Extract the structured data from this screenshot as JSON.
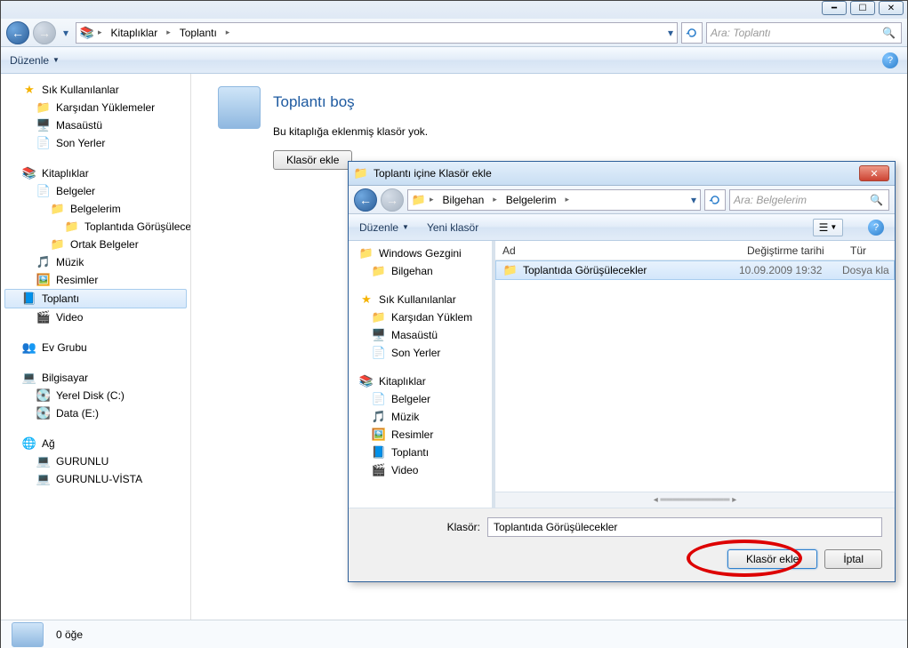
{
  "window": {
    "breadcrumb": [
      "Kitaplıklar",
      "Toplantı"
    ],
    "search_placeholder": "Ara: Toplantı",
    "organize": "Düzenle",
    "lib_title": "Toplantı boş",
    "lib_sub": "Bu kitaplığa eklenmiş klasör yok.",
    "add_folder_btn": "Klasör ekle",
    "status_items": "0 öğe"
  },
  "nav": {
    "fav": "Sık Kullanılanlar",
    "fav_items": [
      "Karşıdan Yüklemeler",
      "Masaüstü",
      "Son Yerler"
    ],
    "libs": "Kitaplıklar",
    "libs_items": {
      "docs": "Belgeler",
      "docs_sub": [
        "Belgelerim",
        "Toplantıda Görüşülecekler",
        "Ortak Belgeler"
      ],
      "music": "Müzik",
      "pics": "Resimler",
      "meeting": "Toplantı",
      "video": "Video"
    },
    "homegroup": "Ev Grubu",
    "computer": "Bilgisayar",
    "drives": [
      "Yerel Disk (C:)",
      "Data (E:)"
    ],
    "network": "Ağ",
    "net_items": [
      "GURUNLU",
      "GURUNLU-VİSTA"
    ]
  },
  "dialog": {
    "title": "Toplantı içine Klasör ekle",
    "breadcrumb": [
      "Bilgehan",
      "Belgelerim"
    ],
    "search_placeholder": "Ara: Belgelerim",
    "organize": "Düzenle",
    "new_folder": "Yeni klasör",
    "cols": {
      "name": "Ad",
      "date": "Değiştirme tarihi",
      "type": "Tür"
    },
    "nav": {
      "root": "Windows Gezgini",
      "user": "Bilgehan",
      "fav": "Sık Kullanılanlar",
      "fav_items": [
        "Karşıdan Yüklem",
        "Masaüstü",
        "Son Yerler"
      ],
      "libs": "Kitaplıklar",
      "libs_items": [
        "Belgeler",
        "Müzik",
        "Resimler",
        "Toplantı",
        "Video"
      ]
    },
    "rows": [
      {
        "name": "Toplantıda Görüşülecekler",
        "date": "10.09.2009 19:32",
        "type": "Dosya kla"
      }
    ],
    "field_label": "Klasör:",
    "field_value": "Toplantıda Görüşülecekler",
    "ok": "Klasör ekle",
    "cancel": "İptal"
  }
}
